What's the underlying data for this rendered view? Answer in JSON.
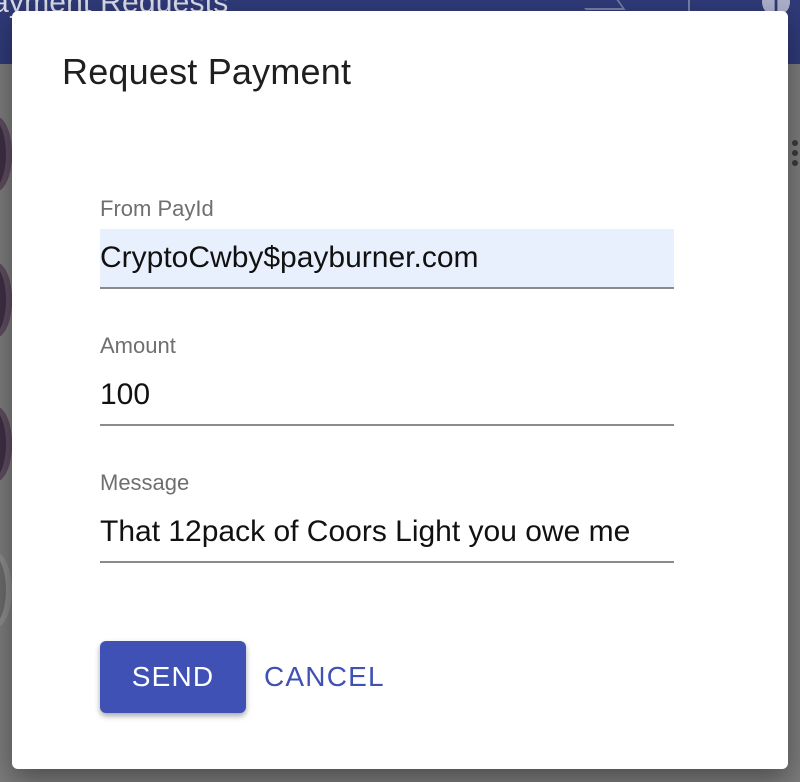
{
  "background": {
    "app_bar_title": "ayment Requests",
    "info_icon": "i"
  },
  "dialog": {
    "title": "Request Payment",
    "fields": {
      "from_payid": {
        "label": "From PayId",
        "value": "CryptoCwby$payburner.com"
      },
      "amount": {
        "label": "Amount",
        "value": "100"
      },
      "message": {
        "label": "Message",
        "value": "That 12pack of Coors Light you owe me"
      }
    },
    "buttons": {
      "send": "SEND",
      "cancel": "CANCEL"
    }
  },
  "colors": {
    "primary": "#3f51b5",
    "app_bar": "#2f3a78",
    "autofill_bg": "#e8f0fe"
  },
  "icons": {
    "info": "info-icon",
    "more": "more-vert-icon"
  }
}
